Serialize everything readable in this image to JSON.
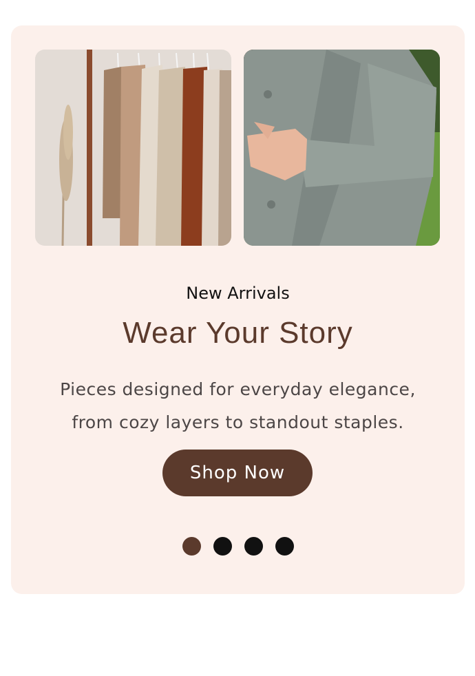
{
  "carousel": {
    "eyebrow": "New Arrivals",
    "headline": "Wear Your Story",
    "body_line1": "Pieces designed for everyday elegance,",
    "body_line2": "from cozy layers to standout staples.",
    "cta_label": "Shop Now",
    "slides_total": 4,
    "active_slide": 1,
    "images": [
      {
        "name": "clothing-rack-photo",
        "icon": "clothing-rack-image"
      },
      {
        "name": "grey-coat-photo",
        "icon": "coat-model-image"
      }
    ]
  },
  "colors": {
    "card_bg": "#fcf0eb",
    "accent": "#5b3a2c",
    "dot_inactive": "#111111",
    "text": "#4c4646"
  }
}
